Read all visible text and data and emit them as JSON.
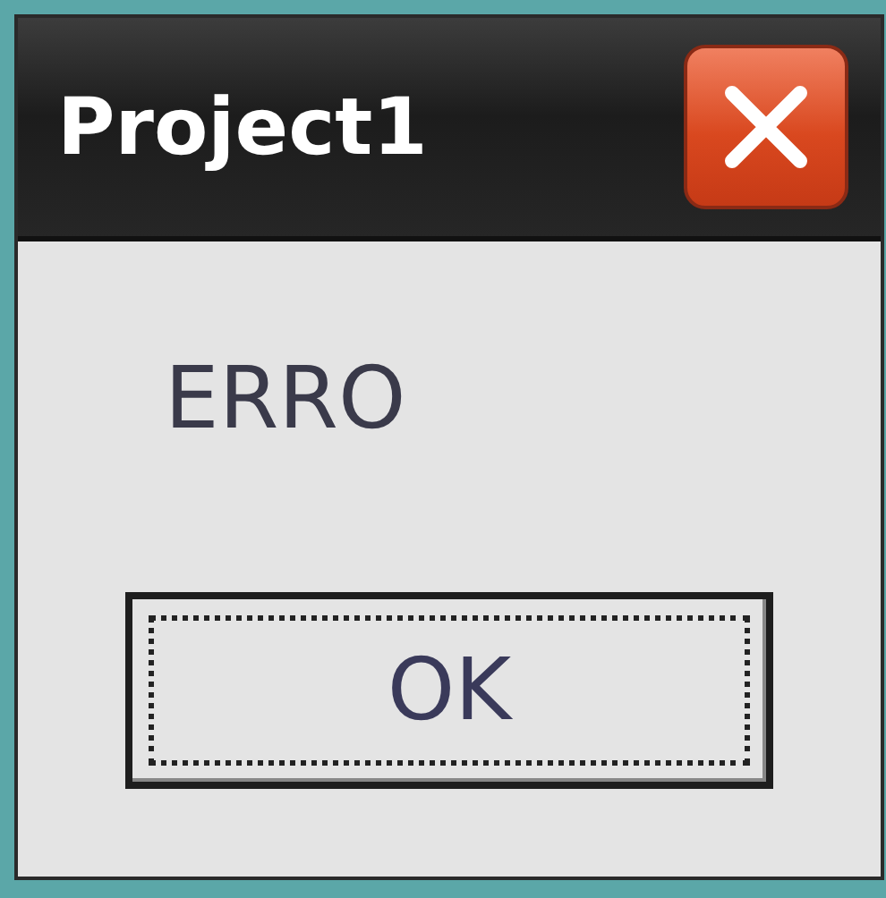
{
  "window": {
    "title": "Project1"
  },
  "message": "ERRO",
  "buttons": [
    {
      "label": "OK",
      "focused": true
    }
  ]
}
